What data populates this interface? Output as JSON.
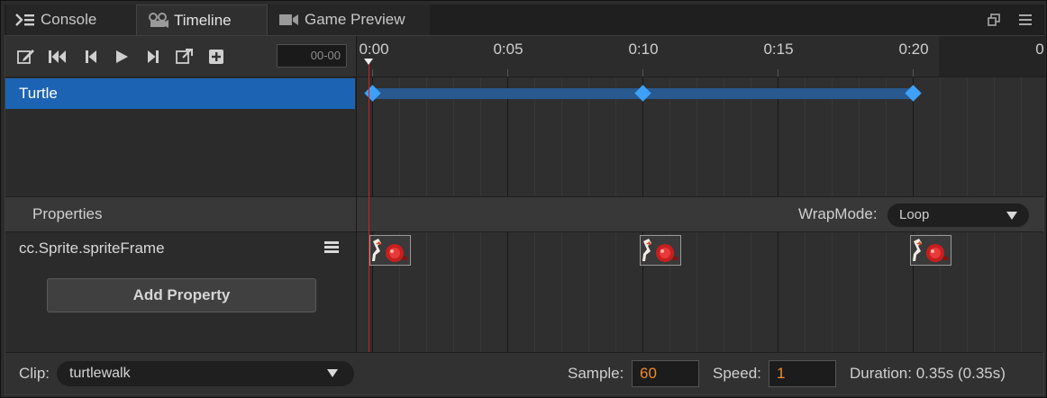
{
  "tabs": [
    {
      "label": "Console",
      "icon": "console-icon"
    },
    {
      "label": "Timeline",
      "icon": "timeline-icon",
      "active": true
    },
    {
      "label": "Game Preview",
      "icon": "video-camera-icon"
    }
  ],
  "toolbar": {
    "icons": [
      "edit-icon",
      "jump-first-icon",
      "step-back-icon",
      "play-icon",
      "step-forward-icon",
      "open-external-icon",
      "add-event-icon"
    ],
    "current_time": "00-00"
  },
  "ruler": {
    "labels": [
      "0:00",
      "0:05",
      "0:10",
      "0:15",
      "0:20",
      "0"
    ]
  },
  "nodes": {
    "items": [
      {
        "label": "Turtle"
      }
    ]
  },
  "properties": {
    "title": "Properties",
    "wrapmode_label": "WrapMode:",
    "wrapmode_value": "Loop",
    "items": [
      {
        "label": "cc.Sprite.spriteFrame"
      }
    ],
    "add_button": "Add Property"
  },
  "footer": {
    "clip_label": "Clip:",
    "clip_value": "turtlewalk",
    "sample_label": "Sample:",
    "sample_value": "60",
    "speed_label": "Speed:",
    "speed_value": "1",
    "duration": "Duration: 0.35s (0.35s)"
  },
  "colors": {
    "selection": "#1c64b3",
    "keyframe": "#3ea0f6",
    "playhead": "#d21f1f",
    "numeric_accent": "#f08a2e"
  }
}
